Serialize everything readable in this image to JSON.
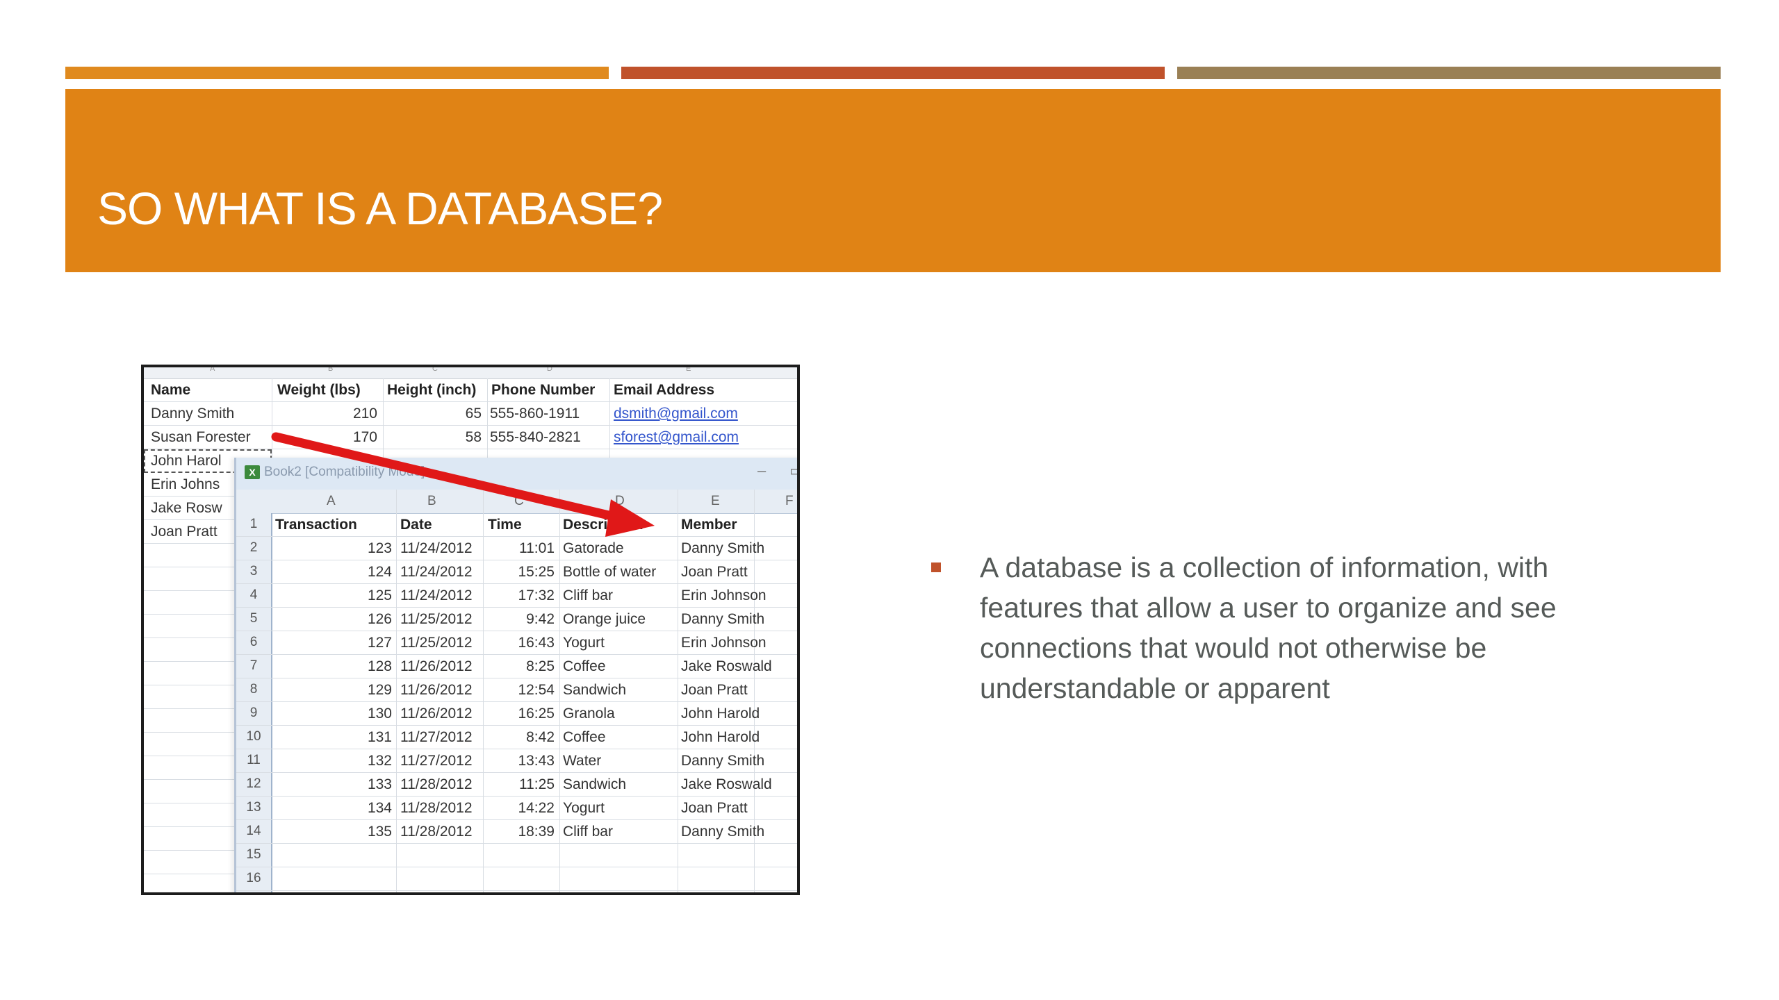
{
  "slide": {
    "title": "SO WHAT IS A DATABASE?",
    "bullet": "A database is a collection of information, with features that allow a user to organize and see connections that would not otherwise be understandable or apparent"
  },
  "colors": {
    "bar1": "#e08a1e",
    "bar2": "#c0522b",
    "bar3": "#9a8055",
    "title_band": "#e08315",
    "bullet": "#c0522b",
    "arrow": "#e01818"
  },
  "screenshot": {
    "back_sheet": {
      "column_letters": [
        "A",
        "B",
        "C",
        "D",
        "E"
      ],
      "headers": [
        "Name",
        "Weight (lbs)",
        "Height (inch)",
        "Phone Number",
        "Email Address"
      ],
      "rows": [
        {
          "name": "Danny Smith",
          "weight": "210",
          "height": "65",
          "phone": "555-860-1911",
          "email": "dsmith@gmail.com"
        },
        {
          "name": "Susan Forester",
          "weight": "170",
          "height": "58",
          "phone": "555-840-2821",
          "email": "sforest@gmail.com"
        },
        {
          "name": "John Harol",
          "weight": "",
          "height": "",
          "phone": "",
          "email": ""
        },
        {
          "name": "Erin Johns",
          "weight": "",
          "height": "",
          "phone": "",
          "email": ""
        },
        {
          "name": "Jake Rosw",
          "weight": "",
          "height": "",
          "phone": "",
          "email": ""
        },
        {
          "name": "Joan Pratt",
          "weight": "",
          "height": "",
          "phone": "",
          "email": ""
        }
      ]
    },
    "front_sheet": {
      "window_title": "Book2 [Compatibility Mode]",
      "column_letters": [
        "A",
        "B",
        "C",
        "D",
        "E",
        "F"
      ],
      "row_numbers": [
        "1",
        "2",
        "3",
        "4",
        "5",
        "6",
        "7",
        "8",
        "9",
        "10",
        "11",
        "12",
        "13",
        "14",
        "15",
        "16"
      ],
      "headers": [
        "Transaction",
        "Date",
        "Time",
        "Description",
        "Member"
      ],
      "rows": [
        {
          "transaction": "123",
          "date": "11/24/2012",
          "time": "11:01",
          "description": "Gatorade",
          "member": "Danny Smith"
        },
        {
          "transaction": "124",
          "date": "11/24/2012",
          "time": "15:25",
          "description": "Bottle of water",
          "member": "Joan Pratt"
        },
        {
          "transaction": "125",
          "date": "11/24/2012",
          "time": "17:32",
          "description": "Cliff bar",
          "member": "Erin Johnson"
        },
        {
          "transaction": "126",
          "date": "11/25/2012",
          "time": "9:42",
          "description": "Orange juice",
          "member": "Danny Smith"
        },
        {
          "transaction": "127",
          "date": "11/25/2012",
          "time": "16:43",
          "description": "Yogurt",
          "member": "Erin Johnson"
        },
        {
          "transaction": "128",
          "date": "11/26/2012",
          "time": "8:25",
          "description": "Coffee",
          "member": "Jake Roswald"
        },
        {
          "transaction": "129",
          "date": "11/26/2012",
          "time": "12:54",
          "description": "Sandwich",
          "member": "Joan Pratt"
        },
        {
          "transaction": "130",
          "date": "11/26/2012",
          "time": "16:25",
          "description": "Granola",
          "member": "John Harold"
        },
        {
          "transaction": "131",
          "date": "11/27/2012",
          "time": "8:42",
          "description": "Coffee",
          "member": "John Harold"
        },
        {
          "transaction": "132",
          "date": "11/27/2012",
          "time": "13:43",
          "description": "Water",
          "member": "Danny Smith"
        },
        {
          "transaction": "133",
          "date": "11/28/2012",
          "time": "11:25",
          "description": "Sandwich",
          "member": "Jake Roswald"
        },
        {
          "transaction": "134",
          "date": "11/28/2012",
          "time": "14:22",
          "description": "Yogurt",
          "member": "Joan Pratt"
        },
        {
          "transaction": "135",
          "date": "11/28/2012",
          "time": "18:39",
          "description": "Cliff bar",
          "member": "Danny Smith"
        }
      ]
    }
  }
}
